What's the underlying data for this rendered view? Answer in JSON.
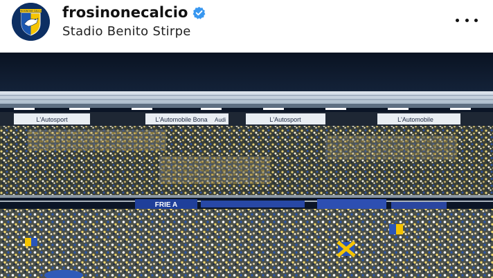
{
  "post": {
    "username": "frosinonecalcio",
    "location": "Stadio Benito Stirpe",
    "verified": true
  },
  "icons": {
    "avatar": "club-crest",
    "verified": "verified-badge-icon",
    "more": "more-options-icon"
  },
  "stadium": {
    "roof_sponsors": [
      "L'Autosport",
      "L'Automobile Bona",
      "Audi",
      "L'Autosport",
      "L'Automobile"
    ],
    "fan_banner": "FRIE A"
  },
  "colors": {
    "verified_blue": "#3897f0",
    "club_navy": "#0d2f63",
    "club_yellow": "#f5c400",
    "sky": "#0b1526"
  }
}
